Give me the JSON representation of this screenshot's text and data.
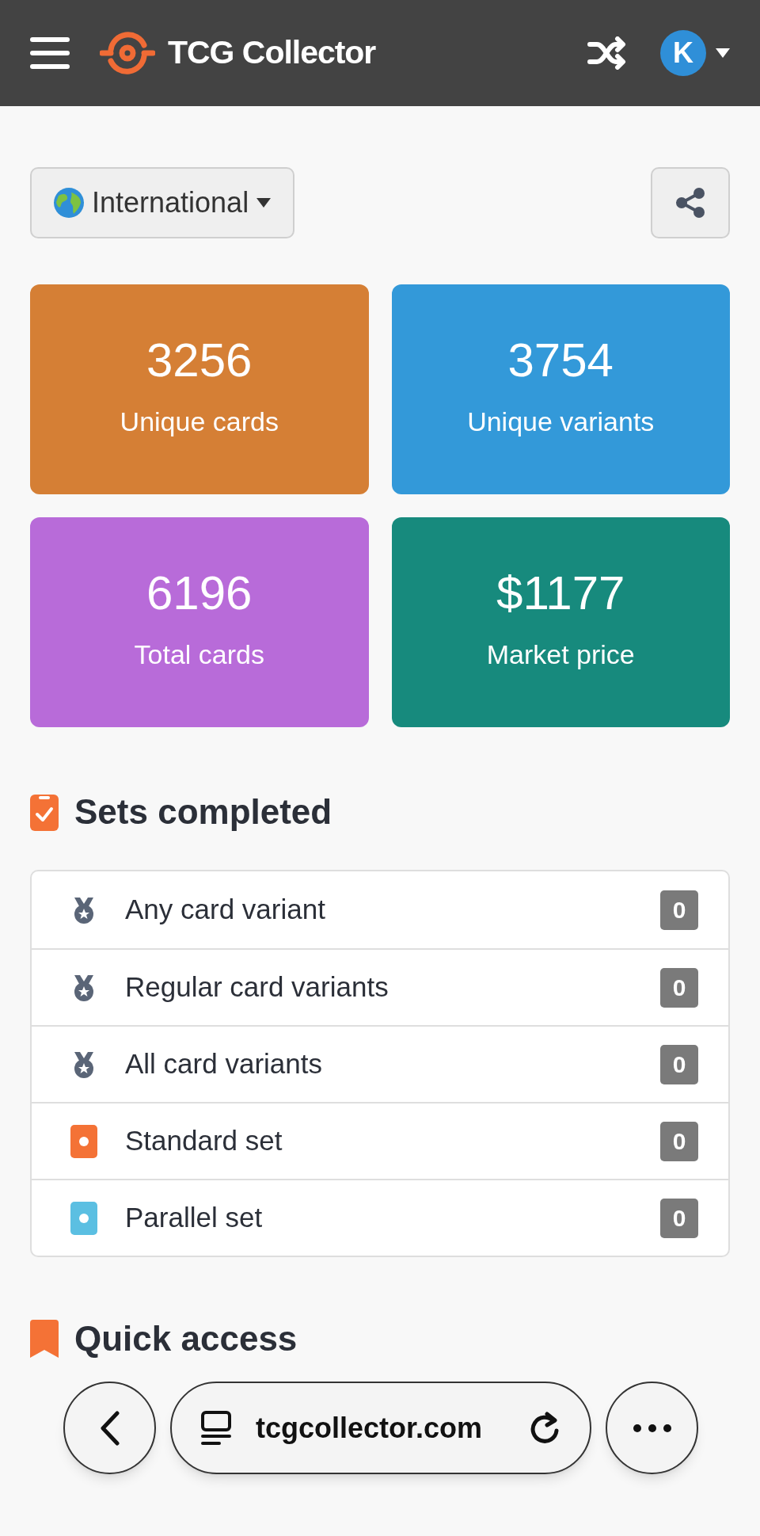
{
  "header": {
    "title": "TCG Collector",
    "avatar_letter": "K"
  },
  "region_select": {
    "label": "International"
  },
  "stats": [
    {
      "value": "3256",
      "label": "Unique cards",
      "color": "#d57f35"
    },
    {
      "value": "3754",
      "label": "Unique variants",
      "color": "#3399d9"
    },
    {
      "value": "6196",
      "label": "Total cards",
      "color": "#b86bd9"
    },
    {
      "value": "$1177",
      "label": "Market price",
      "color": "#178a7d"
    }
  ],
  "sets_completed": {
    "title": "Sets completed",
    "items": [
      {
        "kind": "medal",
        "label": "Any card variant",
        "count": "0"
      },
      {
        "kind": "medal",
        "label": "Regular card variants",
        "count": "0"
      },
      {
        "kind": "medal",
        "label": "All card variants",
        "count": "0"
      },
      {
        "kind": "card",
        "color": "#f47236",
        "label": "Standard set",
        "count": "0"
      },
      {
        "kind": "card",
        "color": "#5bbfe2",
        "label": "Parallel set",
        "count": "0"
      }
    ]
  },
  "quick_access": {
    "title": "Quick access"
  },
  "browser_bar": {
    "url": "tcgcollector.com"
  }
}
